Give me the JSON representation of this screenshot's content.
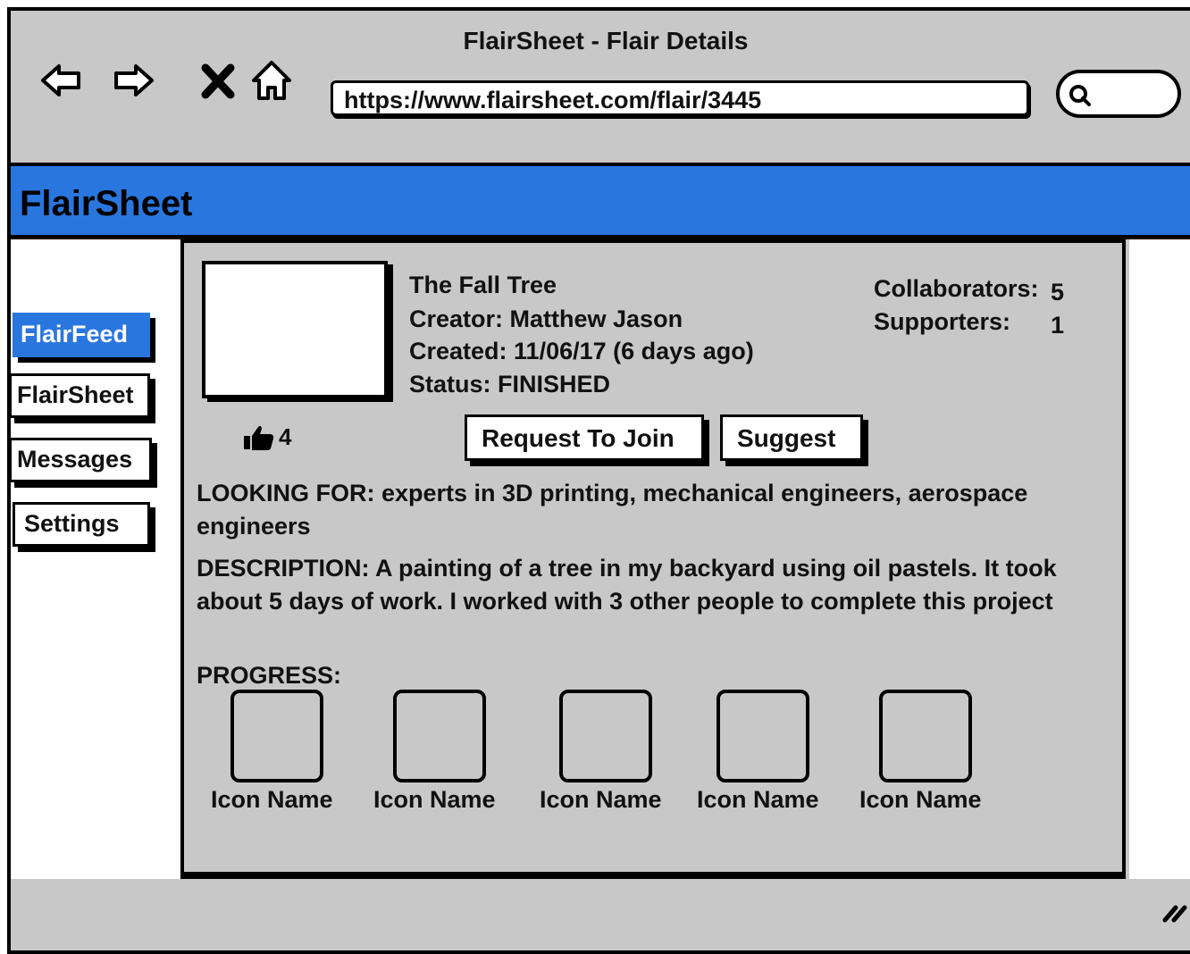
{
  "window": {
    "title": "FlairSheet - Flair Details"
  },
  "browser": {
    "url": "https://www.flairsheet.com/flair/3445",
    "nav_icons": [
      "back-arrow-icon",
      "forward-arrow-icon",
      "close-icon",
      "home-icon"
    ],
    "search_icon": "search-icon"
  },
  "app": {
    "name": "FlairSheet",
    "accent_color": "#2a76df"
  },
  "sidebar": {
    "items": [
      {
        "label": "FlairFeed",
        "active": true
      },
      {
        "label": "FlairSheet",
        "active": false
      },
      {
        "label": "Messages",
        "active": false
      },
      {
        "label": "Settings",
        "active": false
      }
    ]
  },
  "flair": {
    "title": "The Fall Tree",
    "creator": "Creator: Matthew Jason",
    "created": "Created: 11/06/17 (6 days ago)",
    "status": "Status: FINISHED",
    "likes": "4",
    "collaborators_label": "Collaborators:",
    "collaborators_value": "5",
    "supporters_label": "Supporters:",
    "supporters_value": "1"
  },
  "actions": {
    "request_label": "Request To Join",
    "suggest_label": "Suggest"
  },
  "looking_for": "LOOKING FOR: experts in 3D printing, mechanical engineers, aerospace engineers",
  "description": "DESCRIPTION: A painting of a tree in my backyard using oil pastels. It took about 5 days of work. I worked with 3 other people to complete this project",
  "progress": {
    "label": "PROGRESS:",
    "items": [
      {
        "label": "Icon Name"
      },
      {
        "label": "Icon Name"
      },
      {
        "label": "Icon Name"
      },
      {
        "label": "Icon Name"
      },
      {
        "label": "Icon Name"
      }
    ]
  }
}
